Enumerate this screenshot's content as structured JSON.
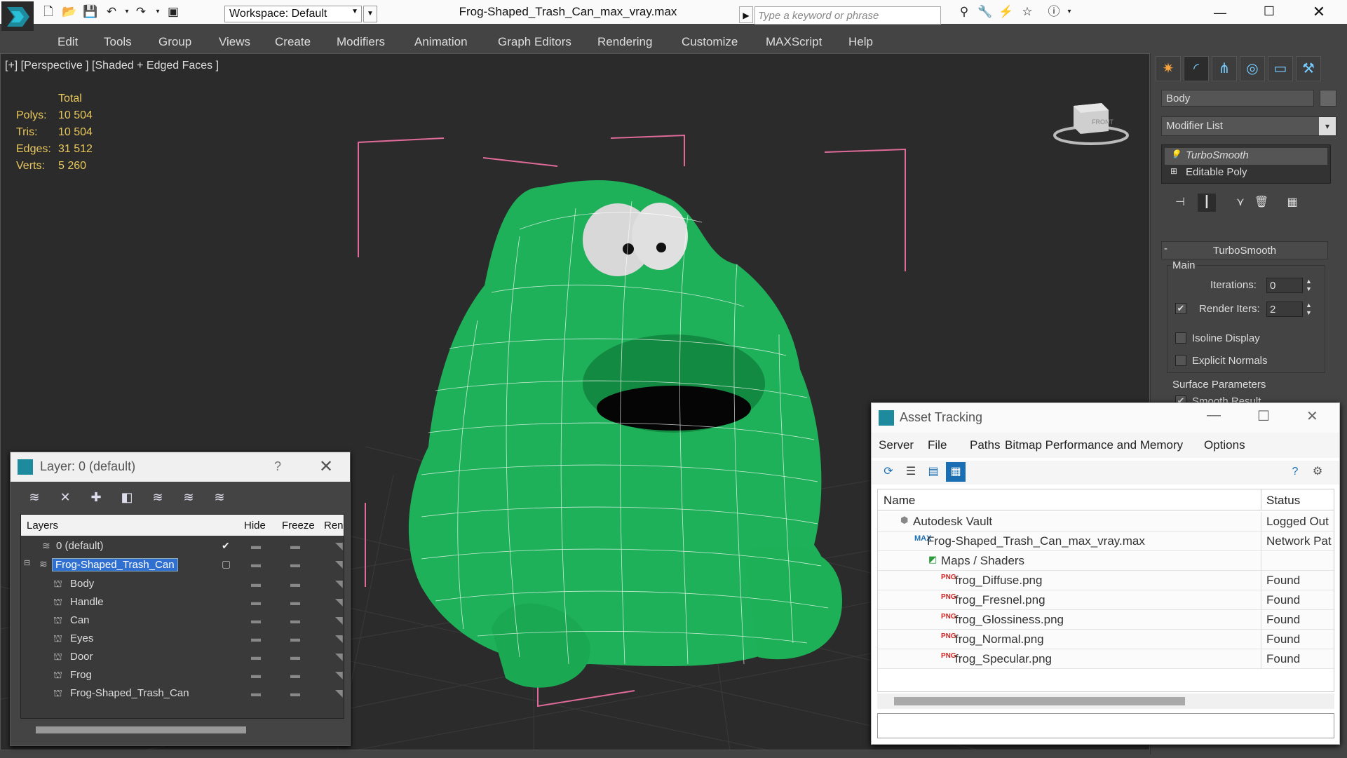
{
  "titlebar": {
    "workspace": "Workspace: Default",
    "doc_title": "Frog-Shaped_Trash_Can_max_vray.max",
    "search_placeholder": "Type a keyword or phrase"
  },
  "menubar": [
    "Edit",
    "Tools",
    "Group",
    "Views",
    "Create",
    "Modifiers",
    "Animation",
    "Graph Editors",
    "Rendering",
    "Customize",
    "MAXScript",
    "Help"
  ],
  "viewport": {
    "label": "[+] [Perspective ] [Shaded + Edged Faces ]",
    "stats": {
      "header": "Total",
      "rows": [
        {
          "label": "Polys:",
          "value": "10 504"
        },
        {
          "label": "Tris:",
          "value": "10 504"
        },
        {
          "label": "Edges:",
          "value": "31 512"
        },
        {
          "label": "Verts:",
          "value": "5 260"
        }
      ]
    },
    "viewcube_label": "FRONT",
    "colors": {
      "model": "#1fb05a",
      "wire": "#ffffff",
      "bbox": "#e06a9a",
      "grid": "#3a3a3a"
    }
  },
  "command_panel": {
    "object_name": "Body",
    "modifier_list": "Modifier List",
    "stack": [
      "TurboSmooth",
      "Editable Poly"
    ],
    "rollout": {
      "title": "TurboSmooth",
      "group": "Main",
      "iterations_label": "Iterations:",
      "iterations_value": "0",
      "render_iters_label": "Render Iters:",
      "render_iters_value": "2",
      "isoline": "Isoline Display",
      "explicit_normals": "Explicit Normals",
      "surface_params": "Surface Parameters",
      "smooth_result": "Smooth Result"
    }
  },
  "layer_window": {
    "title": "Layer: 0 (default)",
    "help": "?",
    "columns": {
      "layers": "Layers",
      "hide": "Hide",
      "freeze": "Freeze",
      "render": "Ren"
    },
    "rows": [
      {
        "name": "0 (default)",
        "indent": 1,
        "check": "✔"
      },
      {
        "name": "Frog-Shaped_Trash_Can",
        "indent": 0,
        "selected": true
      },
      {
        "name": "Body",
        "indent": 2
      },
      {
        "name": "Handle",
        "indent": 2
      },
      {
        "name": "Can",
        "indent": 2
      },
      {
        "name": "Eyes",
        "indent": 2
      },
      {
        "name": "Door",
        "indent": 2
      },
      {
        "name": "Frog",
        "indent": 2
      },
      {
        "name": "Frog-Shaped_Trash_Can",
        "indent": 2
      }
    ]
  },
  "asset_window": {
    "title": "Asset Tracking",
    "menu": [
      "Server",
      "File",
      "Paths",
      "Bitmap Performance and Memory",
      "Options"
    ],
    "columns": {
      "name": "Name",
      "status": "Status"
    },
    "rows": [
      {
        "name": "Autodesk Vault",
        "status": "Logged Out",
        "indent": 1,
        "icon": "vault-icon"
      },
      {
        "name": "Frog-Shaped_Trash_Can_max_vray.max",
        "status": "Network Pat",
        "indent": 2,
        "icon": "max-file-icon"
      },
      {
        "name": "Maps / Shaders",
        "status": "",
        "indent": 3,
        "icon": "maps-icon"
      },
      {
        "name": "frog_Diffuse.png",
        "status": "Found",
        "indent": 4,
        "icon": "png-icon"
      },
      {
        "name": "frog_Fresnel.png",
        "status": "Found",
        "indent": 4,
        "icon": "png-icon"
      },
      {
        "name": "frog_Glossiness.png",
        "status": "Found",
        "indent": 4,
        "icon": "png-icon"
      },
      {
        "name": "frog_Normal.png",
        "status": "Found",
        "indent": 4,
        "icon": "png-icon"
      },
      {
        "name": "frog_Specular.png",
        "status": "Found",
        "indent": 4,
        "icon": "png-icon"
      }
    ]
  }
}
